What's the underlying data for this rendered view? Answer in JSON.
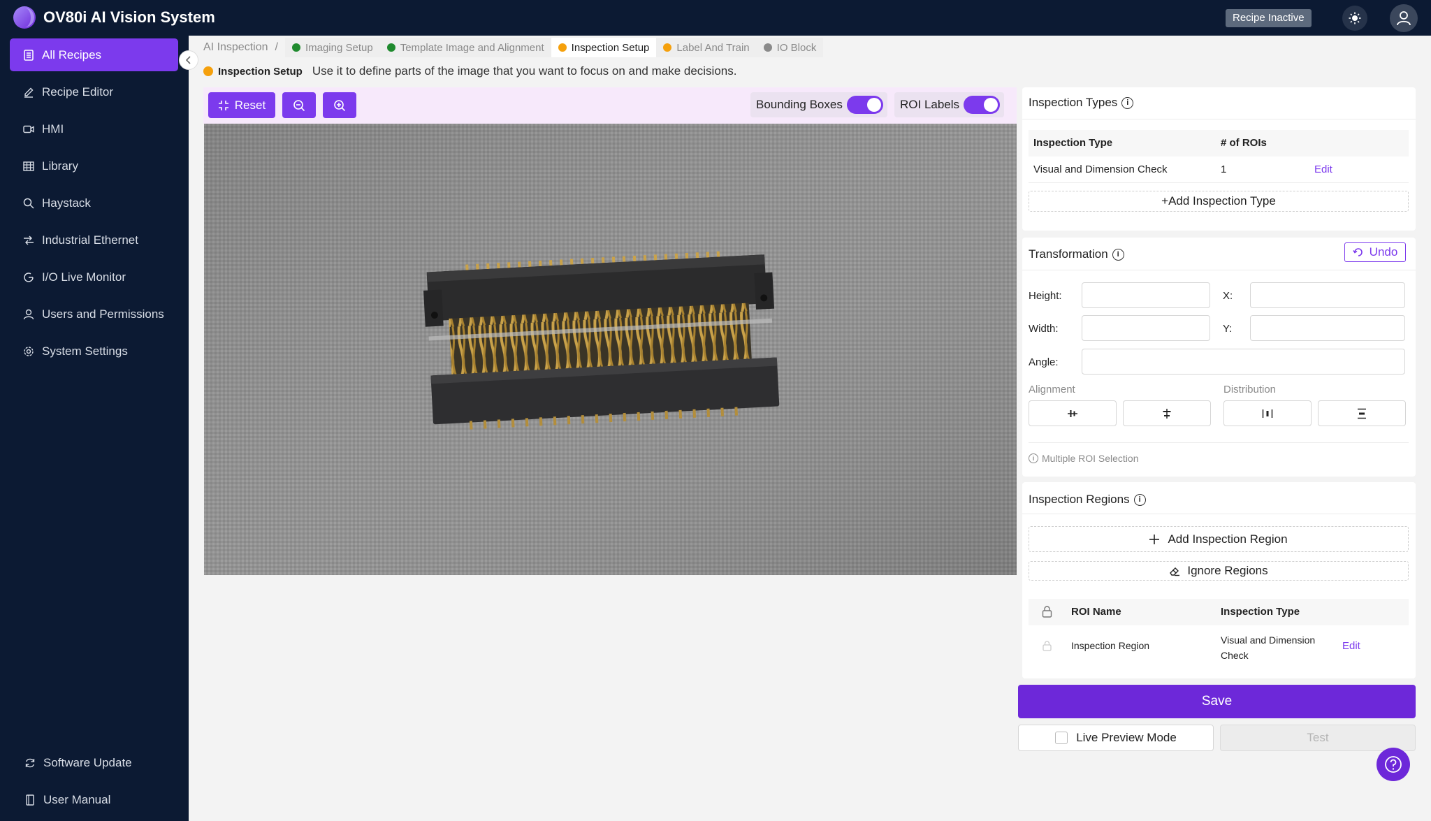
{
  "app": {
    "title": "OV80i AI Vision System",
    "recipe_status": "Recipe Inactive"
  },
  "sidebar": {
    "items": [
      {
        "label": "All Recipes",
        "icon": "list-icon"
      },
      {
        "label": "Recipe Editor",
        "icon": "edit-icon"
      },
      {
        "label": "HMI",
        "icon": "video-icon"
      },
      {
        "label": "Library",
        "icon": "grid-icon"
      },
      {
        "label": "Haystack",
        "icon": "search-icon"
      },
      {
        "label": "Industrial Ethernet",
        "icon": "network-icon"
      },
      {
        "label": "I/O Live Monitor",
        "icon": "monitor-icon"
      },
      {
        "label": "Users and Permissions",
        "icon": "user-icon"
      },
      {
        "label": "System Settings",
        "icon": "gear-icon"
      }
    ],
    "bottom": [
      {
        "label": "Software Update",
        "icon": "refresh-icon"
      },
      {
        "label": "User Manual",
        "icon": "book-icon"
      }
    ]
  },
  "breadcrumb": {
    "root": "AI Inspection",
    "separator": "/",
    "steps": [
      {
        "label": "Imaging Setup",
        "color": "#1f8a2e"
      },
      {
        "label": "Template Image and Alignment",
        "color": "#1f8a2e"
      },
      {
        "label": "Inspection Setup",
        "color": "#f5a00c"
      },
      {
        "label": "Label And Train",
        "color": "#f5a00c"
      },
      {
        "label": "IO Block",
        "color": "#8a8a8a"
      }
    ]
  },
  "step_desc": {
    "name": "Inspection Setup",
    "text": "Use it to define parts of the image that you want to focus on and make decisions."
  },
  "toolbar": {
    "reset_label": "Reset",
    "bounding_boxes_label": "Bounding Boxes",
    "roi_labels_label": "ROI Labels"
  },
  "inspection_types": {
    "title": "Inspection Types",
    "headers": {
      "type": "Inspection Type",
      "rois": "# of ROIs"
    },
    "rows": [
      {
        "type": "Visual and Dimension Check",
        "rois": "1",
        "action": "Edit"
      }
    ],
    "add_label": "+Add Inspection Type"
  },
  "transformation": {
    "title": "Transformation",
    "undo_label": "Undo",
    "height_label": "Height:",
    "width_label": "Width:",
    "x_label": "X:",
    "y_label": "Y:",
    "angle_label": "Angle:",
    "alignment_label": "Alignment",
    "distribution_label": "Distribution",
    "multi_roi_label": "Multiple ROI Selection"
  },
  "inspection_regions": {
    "title": "Inspection Regions",
    "add_label": "Add Inspection Region",
    "ignore_label": "Ignore Regions",
    "headers": {
      "name": "ROI Name",
      "type": "Inspection Type"
    },
    "rows": [
      {
        "name": "Inspection Region",
        "type_line1": "Visual and Dimension",
        "type_line2": "Check",
        "action": "Edit"
      }
    ]
  },
  "actions": {
    "save_label": "Save",
    "live_preview_label": "Live Preview Mode",
    "test_label": "Test"
  },
  "colors": {
    "accent": "#7c3aed",
    "nav_bg": "#0c1a33"
  }
}
